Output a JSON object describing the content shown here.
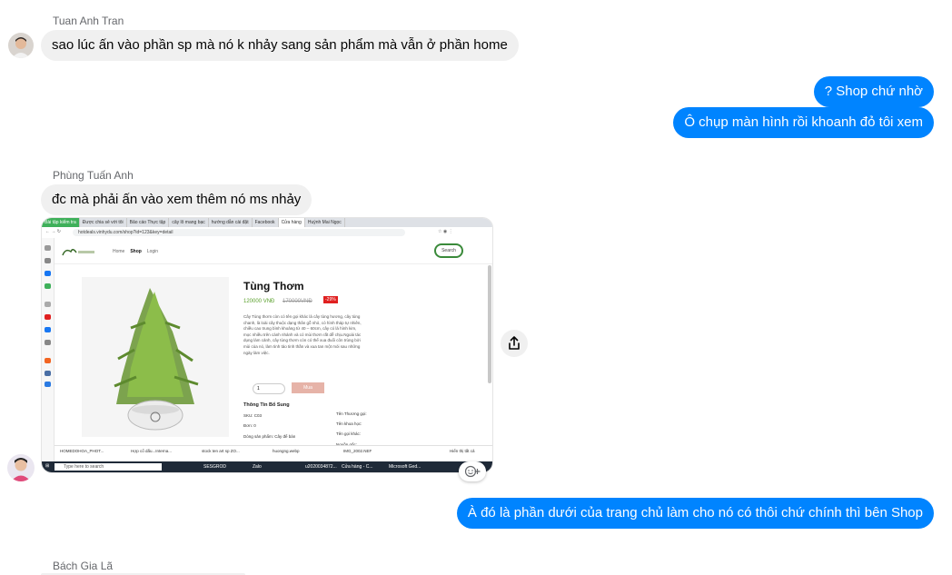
{
  "messages": [
    {
      "sender": "Tuan Anh Tran",
      "text": "sao lúc ấn vào phần sp mà nó k nhảy sang sản phẩm mà vẫn ở phần home",
      "direction": "in"
    },
    {
      "text": "? Shop chứ nhờ",
      "direction": "out"
    },
    {
      "text": "Ô chụp màn hình rồi khoanh đỏ tôi xem",
      "direction": "out"
    },
    {
      "sender": "Phùng Tuấn Anh",
      "text": "đc mà phải ấn vào xem thêm nó ms nhảy",
      "direction": "in"
    },
    {
      "text": "À đó là phần dưới của trang chủ làm cho nó có thôi chứ chính thì bên Shop",
      "direction": "out"
    },
    {
      "sender": "Bách Gia Lã",
      "direction": "in"
    }
  ],
  "attachment": {
    "tabs": [
      "Bài tập kiểm tra",
      "Được chia sẻ với tôi",
      "Bảo cáo Thực tập",
      "cây lô mang bạc",
      "hướng dẫn cài đặt",
      "Facebook",
      "Cửa hàng",
      "Huỳnh Mai Ngọc"
    ],
    "url": "hotdeals.vinhydu.com/shop?id=123&key=detail",
    "nav_links": [
      "Home",
      "Shop",
      "Login"
    ],
    "search_label": "Search",
    "product": {
      "name": "Tùng Thơm",
      "price": "120000 VNĐ",
      "old_price": "170000VNĐ",
      "discount": "-29%",
      "description": "Cây Tùng thơm còn có tên gọi khác là cây tùng hương, cây tùng chanh, là loài cây thuộc dạng thân gỗ nhỏ, có hình tháp tự nhiên, chiều cao trung bình khoảng từ 40 – 60cm, cây có lá hình kim, mọc nhiều trên cành nhánh và có mùi thơm rất dễ chịu.Ngoài tác dụng làm cảnh, cây tùng thơm còn có thể xua đuổi côn trùng bởi mùi của nó, làm tinh tảo tinh thần và xua tan một mỏi sau những ngày làm việc.",
      "quantity": "1",
      "buy_label": "Mua",
      "specs_title": "Thông Tin Bổ Sung",
      "specs_left": [
        "SKU: C03",
        "Đơn: 0",
        "Dòng sản phẩm: Cây để bàn"
      ],
      "specs_right": [
        "Tên Thương gọi:",
        "Tên khoa học:",
        "Tên gọi khác:",
        "Nguồn gốc:"
      ]
    },
    "downloads": [
      "HOMEDOHOA_PHOT...",
      "Hợp cổ dấu...Interna...",
      "stock ten art sp ZO...",
      "huongng.webp",
      "IMG_2002.NEF"
    ],
    "downloads_right": "Hiển thị tất cả",
    "taskbar_search": "Type here to search",
    "taskbar_apps": [
      "SESGROD",
      "Zalo",
      "u2020034872...",
      "Cửa hàng - C...",
      "Microsoft Ged..."
    ]
  },
  "colors": {
    "outgoing_bubble": "#0084ff",
    "incoming_bubble": "#f0f0f0",
    "sender_name": "#65676b"
  },
  "icons": [
    "share-icon",
    "add-reaction-icon",
    "avatar-tuan-anh-tran",
    "avatar-self"
  ]
}
